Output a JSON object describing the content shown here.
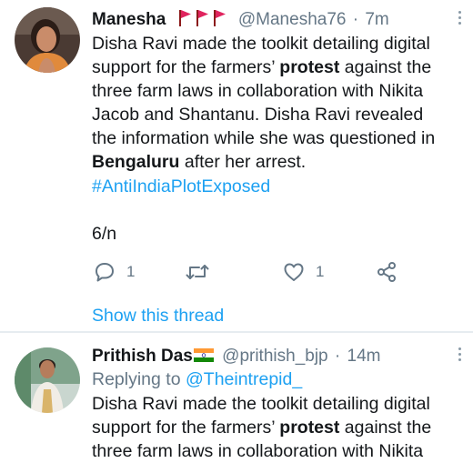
{
  "tweets": [
    {
      "display_name": "Manesha",
      "handle": "@Manesha76",
      "separator": "·",
      "time": "7m",
      "text_segments": [
        "Disha Ravi made the toolkit detailing digital support for the farmers’ ",
        "protest",
        " against the three farm laws in collaboration with Nikita Jacob and Shantanu. Disha Ravi revealed the information while she was questioned in ",
        "Bengaluru",
        " after her arrest."
      ],
      "hashtag": "#AntiIndiaPlotExposed",
      "counter": "6/n",
      "reply_count": "1",
      "like_count": "1",
      "show_thread": "Show this thread",
      "icons": [
        "red-flag-icon",
        "more-options-icon",
        "reply-icon",
        "retweet-icon",
        "like-icon",
        "share-icon"
      ]
    },
    {
      "display_name": "Prithish Das",
      "handle": "@prithish_bjp",
      "separator": "·",
      "time": "14m",
      "replying_to_prefix": "Replying to ",
      "replying_to_handle": "@Theintrepid_",
      "text_segments": [
        "Disha Ravi made the toolkit detailing digital support for the farmers’ ",
        "protest",
        " against the three farm laws in collaboration with Nikita"
      ],
      "icons": [
        "india-flag-icon",
        "more-options-icon"
      ]
    }
  ],
  "colors": {
    "link_blue": "#1da1f2",
    "secondary_gray": "#657786",
    "text_black": "#14171a",
    "flag_red": "#e0245e"
  }
}
